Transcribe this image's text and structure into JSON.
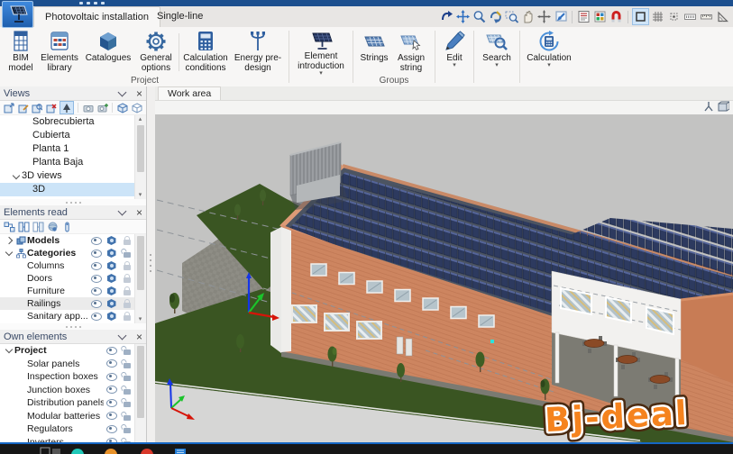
{
  "tabs": {
    "items": [
      {
        "label": "Photovoltaic installation",
        "active": true
      },
      {
        "label": "Single-line",
        "active": false
      }
    ]
  },
  "quick_toolbar": {
    "icons": [
      "previous-view",
      "zoom-extents",
      "zoom-scale",
      "redraw",
      "zoom-window",
      "pan",
      "move-view",
      "send-to-window",
      "dxf-dwg-template",
      "dxf-dwg-layers",
      "snap-magnet",
      "ortho-mode",
      "grid",
      "object-snap",
      "dimension",
      "ruler",
      "protractor"
    ],
    "active": "ortho-mode"
  },
  "ribbon": {
    "groups": [
      {
        "label": "Project",
        "buttons": [
          {
            "label": "BIM model"
          },
          {
            "label": "Elements library"
          },
          {
            "label": "Catalogues"
          },
          {
            "label": "General options"
          },
          {
            "label": "Calculation conditions"
          },
          {
            "label": "Energy pre-design"
          }
        ]
      },
      {
        "label": "",
        "buttons": [
          {
            "label": "Element introduction",
            "dropdown": true
          }
        ]
      },
      {
        "label": "Groups",
        "buttons": [
          {
            "label": "Strings"
          },
          {
            "label": "Assign string"
          }
        ]
      },
      {
        "label": "",
        "buttons": [
          {
            "label": "Edit",
            "dropdown": true
          }
        ]
      },
      {
        "label": "",
        "buttons": [
          {
            "label": "Search",
            "dropdown": true
          }
        ]
      },
      {
        "label": "",
        "buttons": [
          {
            "label": "Calculation",
            "dropdown": true
          }
        ]
      }
    ]
  },
  "sidebar": {
    "views": {
      "title": "Views",
      "toolbar_icons": [
        "new-view",
        "edit-view",
        "duplicate-view",
        "delete-view",
        "3d-view",
        "camera",
        "camera-add",
        "box-open",
        "box-link"
      ],
      "items": [
        {
          "label": "Sobrecubierta"
        },
        {
          "label": "Cubierta"
        },
        {
          "label": "Planta 1"
        },
        {
          "label": "Planta Baja"
        },
        {
          "label": "3D views",
          "group": true,
          "state": "expanded"
        },
        {
          "label": "3D",
          "selected": true
        }
      ]
    },
    "elements_read": {
      "title": "Elements read",
      "toolbar_icons": [
        "link-pair",
        "link-horizontal",
        "link-vertical",
        "sphere-visibility",
        "reference-pin"
      ],
      "rows": [
        {
          "label": "Models",
          "state": "collapsed",
          "icon": "model-boxes",
          "lock": "closed"
        },
        {
          "label": "Categories",
          "state": "expanded",
          "icon": "category-tree",
          "lock": "open-dark"
        },
        {
          "label": "Columns",
          "lock": "closed"
        },
        {
          "label": "Doors",
          "lock": "closed"
        },
        {
          "label": "Furniture",
          "lock": "closed"
        },
        {
          "label": "Railings",
          "lock": "closed",
          "hover": true
        },
        {
          "label": "Sanitary app...",
          "lock": "closed"
        }
      ]
    },
    "own_elements": {
      "title": "Own elements",
      "rows": [
        {
          "label": "Project",
          "state": "expanded",
          "lock": "open"
        },
        {
          "label": "Solar panels",
          "lock": "open"
        },
        {
          "label": "Inspection boxes",
          "lock": "open"
        },
        {
          "label": "Junction boxes",
          "lock": "open"
        },
        {
          "label": "Distribution panels",
          "lock": "open"
        },
        {
          "label": "Modular batteries",
          "lock": "open"
        },
        {
          "label": "Regulators",
          "lock": "open"
        },
        {
          "label": "Inverters",
          "lock": "open"
        }
      ]
    }
  },
  "work_area": {
    "tab": "Work area",
    "view_icons": [
      "axes-tripod",
      "view-cube"
    ]
  },
  "watermark": {
    "text": "Bj-deal",
    "color": "#f5831e"
  },
  "colors": {
    "accent": "#2e75c8",
    "selection": "#cce4f8",
    "titlebar": "#1c4f8e",
    "viewport_bg": "#c3c3c2",
    "roof": "#4c5462",
    "solar_panel": "#2d3a5f",
    "parapet": "#d6906c",
    "brick": "#cd8560",
    "grass": "#3a5522",
    "pavement": "#8e8d85",
    "road": "#d6d6d5",
    "canopy": "#f2f1ef",
    "terracotta": "#c87c55",
    "axis_x": "#d61408",
    "axis_y": "#1bc32b",
    "axis_z": "#1535e8",
    "taskbar": "#161616"
  }
}
